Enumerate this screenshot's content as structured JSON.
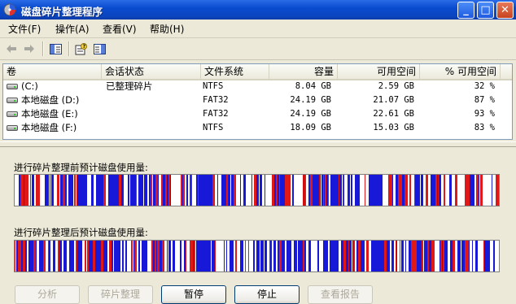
{
  "window": {
    "title": "磁盘碎片整理程序",
    "buttons": {
      "minimize": "_",
      "maximize": "□",
      "close": "✕"
    }
  },
  "menu": [
    "文件(F)",
    "操作(A)",
    "查看(V)",
    "帮助(H)"
  ],
  "toolbar": {
    "icons": [
      "back-arrow-icon",
      "forward-arrow-icon",
      "console-tree-icon",
      "properties-help-icon",
      "show-hide-icon"
    ]
  },
  "volume_list": {
    "columns": [
      "卷",
      "会话状态",
      "文件系统",
      "容量",
      "可用空间",
      "% 可用空间"
    ],
    "rows": [
      {
        "volume": "(C:)",
        "status": "已整理碎片",
        "fs": "NTFS",
        "capacity": "8.04 GB",
        "free": "2.59 GB",
        "free_pct": "32 %"
      },
      {
        "volume": "本地磁盘 (D:)",
        "status": "",
        "fs": "FAT32",
        "capacity": "24.19 GB",
        "free": "21.07 GB",
        "free_pct": "87 %"
      },
      {
        "volume": "本地磁盘 (E:)",
        "status": "",
        "fs": "FAT32",
        "capacity": "24.19 GB",
        "free": "22.61 GB",
        "free_pct": "93 %"
      },
      {
        "volume": "本地磁盘 (F:)",
        "status": "",
        "fs": "NTFS",
        "capacity": "18.09 GB",
        "free": "15.03 GB",
        "free_pct": "83 %"
      }
    ]
  },
  "analysis": {
    "before_label": "进行碎片整理前预计磁盘使用量:",
    "after_label": "进行碎片整理后预计磁盘使用量:"
  },
  "colors": {
    "fragmented": "#E01818",
    "contiguous": "#1818D8",
    "system": "#20A020",
    "free": "#FFFFFF"
  },
  "buttons": [
    {
      "label": "分析",
      "enabled": false
    },
    {
      "label": "碎片整理",
      "enabled": false
    },
    {
      "label": "暂停",
      "enabled": true
    },
    {
      "label": "停止",
      "enabled": true
    },
    {
      "label": "查看报告",
      "enabled": false
    }
  ]
}
